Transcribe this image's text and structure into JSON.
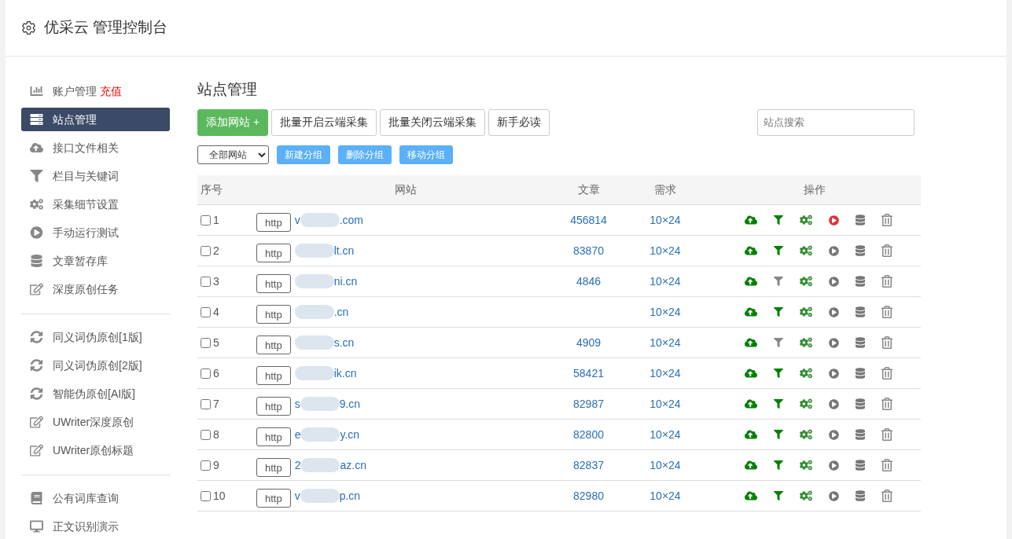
{
  "header": {
    "title": "优采云 管理控制台"
  },
  "sidebar": {
    "groups": [
      [
        {
          "label": "账户管理",
          "badge": "充值",
          "selected": false
        },
        {
          "label": "站点管理",
          "selected": true
        },
        {
          "label": "接口文件相关",
          "selected": false
        },
        {
          "label": "栏目与关键词",
          "selected": false
        },
        {
          "label": "采集细节设置",
          "selected": false
        },
        {
          "label": "手动运行测试",
          "selected": false
        },
        {
          "label": "文章暂存库",
          "selected": false
        },
        {
          "label": "深度原创任务",
          "selected": false
        }
      ],
      [
        {
          "label": "同义词伪原创[1版]",
          "selected": false
        },
        {
          "label": "同义词伪原创[2版]",
          "selected": false
        },
        {
          "label": "智能伪原创[AI版]",
          "selected": false
        },
        {
          "label": "UWriter深度原创",
          "selected": false
        },
        {
          "label": "UWriter原创标题",
          "selected": false
        }
      ],
      [
        {
          "label": "公有词库查询",
          "selected": false
        },
        {
          "label": "正文识别演示",
          "selected": false
        }
      ]
    ]
  },
  "main": {
    "title": "站点管理",
    "buttons": [
      {
        "label": "添加网站 +",
        "kind": "primary"
      },
      {
        "label": "批量开启云端采集",
        "kind": "default"
      },
      {
        "label": "批量关闭云端采集",
        "kind": "default"
      },
      {
        "label": "新手必读",
        "kind": "default"
      }
    ],
    "search": {
      "placeholder": "站点搜索"
    },
    "group_select": {
      "value": "全部网站"
    },
    "group_buttons": [
      "新建分组",
      "删除分组",
      "移动分组"
    ],
    "table": {
      "columns": [
        "序号",
        "网站",
        "文章",
        "需求",
        "操作"
      ],
      "rows": [
        {
          "checked": false,
          "index": "1",
          "protocol": "http",
          "domain_start": "v",
          "domain_end": ".com",
          "articles": "456814",
          "demand": "10×24",
          "filter_on": true,
          "running": true
        },
        {
          "checked": false,
          "index": "2",
          "protocol": "http",
          "domain_end": "lt.cn",
          "articles": "83870",
          "demand": "10×24",
          "filter_on": true,
          "running": false
        },
        {
          "checked": false,
          "index": "3",
          "protocol": "http",
          "domain_end": "ni.cn",
          "articles": "4846",
          "demand": "10×24",
          "filter_on": false,
          "running": false
        },
        {
          "checked": false,
          "index": "4",
          "protocol": "http",
          "domain_end": ".cn",
          "demand": "10×24",
          "filter_on": true,
          "running": false
        },
        {
          "checked": false,
          "index": "5",
          "protocol": "http",
          "domain_end": "s.cn",
          "articles": "4909",
          "demand": "10×24",
          "filter_on": false,
          "running": false
        },
        {
          "checked": false,
          "index": "6",
          "protocol": "http",
          "domain_end": "ik.cn",
          "articles": "58421",
          "demand": "10×24",
          "filter_on": true,
          "running": false
        },
        {
          "checked": false,
          "index": "7",
          "protocol": "http",
          "domain_start": "s",
          "domain_end": "9.cn",
          "articles": "82987",
          "demand": "10×24",
          "filter_on": true,
          "running": false
        },
        {
          "checked": false,
          "index": "8",
          "protocol": "http",
          "domain_start": "e",
          "domain_end": "y.cn",
          "articles": "82800",
          "demand": "10×24",
          "filter_on": true,
          "running": false
        },
        {
          "checked": false,
          "index": "9",
          "protocol": "http",
          "domain_start": "2",
          "domain_end": "az.cn",
          "articles": "82837",
          "demand": "10×24",
          "filter_on": true,
          "running": false
        },
        {
          "checked": false,
          "index": "10",
          "protocol": "http",
          "domain_start": "v",
          "domain_end": "p.cn",
          "articles": "82980",
          "demand": "10×24",
          "filter_on": true,
          "running": false
        }
      ]
    }
  }
}
